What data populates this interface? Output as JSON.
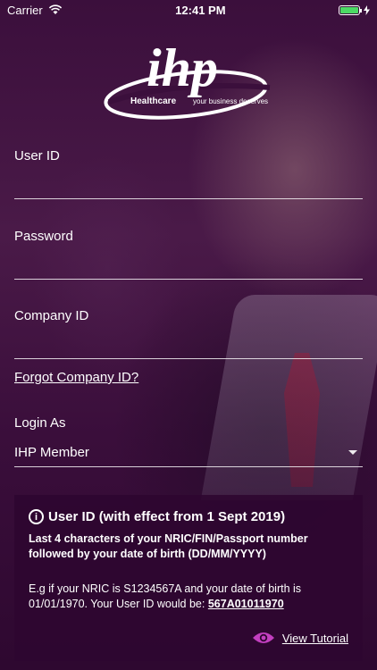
{
  "status_bar": {
    "carrier": "Carrier",
    "time": "12:41 PM"
  },
  "logo": {
    "brand": "ihp",
    "healthcare": "Healthcare",
    "tagline": "your business deserves"
  },
  "form": {
    "user_id_label": "User ID",
    "user_id_value": "",
    "password_label": "Password",
    "password_value": "",
    "company_id_label": "Company ID",
    "company_id_value": "",
    "forgot_company_id": "Forgot Company ID?",
    "login_as_label": "Login As",
    "login_as_value": "IHP Member"
  },
  "info": {
    "title": "User ID (with effect from 1 Sept 2019)",
    "description": "Last 4 characters of your NRIC/FIN/Passport number followed by your date of birth (DD/MM/YYYY)",
    "example_prefix": "E.g if your NRIC is S1234567A and your date of birth is 01/01/1970. Your User ID would be:",
    "example_user_id": "567A01011970",
    "tutorial_link": "View Tutorial"
  },
  "colors": {
    "accent_eye": "#c23fbf",
    "background": "#3a0b3a",
    "battery": "#4cd964"
  }
}
